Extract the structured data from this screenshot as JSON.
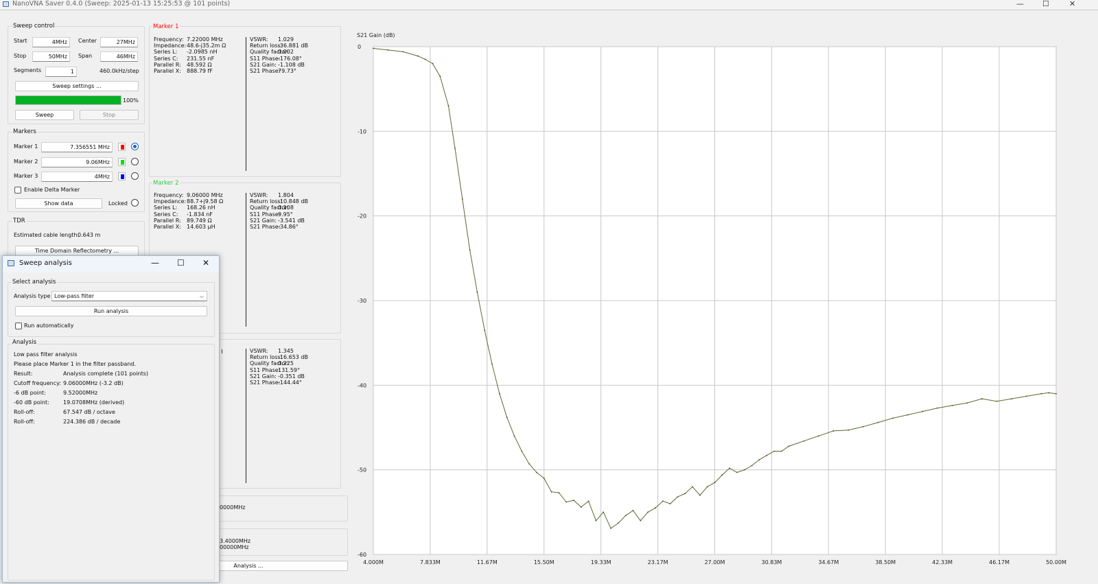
{
  "window": {
    "title": "NanoVNA Saver 0.4.0 (Sweep: 2025-01-13 15:25:53 @ 101 points)",
    "minimize": "—",
    "maximize": "☐",
    "close": "✕"
  },
  "sweep_control": {
    "title": "Sweep control",
    "start_label": "Start",
    "start_value": "4MHz",
    "center_label": "Center",
    "center_value": "27MHz",
    "stop_label": "Stop",
    "stop_value": "50MHz",
    "span_label": "Span",
    "span_value": "46MHz",
    "segments_label": "Segments",
    "segments_value": "1",
    "step_text": "460.0kHz/step",
    "settings_button": "Sweep settings ...",
    "progress": 100,
    "progress_text": "100%",
    "sweep_button": "Sweep",
    "stop_button": "Stop"
  },
  "markers": {
    "title": "Markers",
    "items": [
      {
        "label": "Marker 1",
        "value": "7.356551 MHz",
        "color": "#ff0000",
        "selected": true
      },
      {
        "label": "Marker 2",
        "value": "9.06MHz",
        "color": "#00e000",
        "selected": false
      },
      {
        "label": "Marker 3",
        "value": "4MHz",
        "color": "#0000ff",
        "selected": false
      }
    ],
    "delta_label": "Enable Delta Marker",
    "show_data_button": "Show data",
    "locked_label": "Locked"
  },
  "tdr": {
    "title": "TDR",
    "cable_label": "Estimated cable length:",
    "cable_value": "0.643 m",
    "tdr_button": "Time Domain Reflectometry ..."
  },
  "marker_panels": [
    {
      "title": "Marker 1",
      "color": "#ff0000",
      "left": [
        [
          "Frequency:",
          "7.22000 MHz"
        ],
        [
          "Impedance:",
          "48.6-j35.2m Ω"
        ],
        [
          "Series L:",
          "-2.0985 nH"
        ],
        [
          "Series C:",
          "231.55 nF"
        ],
        [
          "Parallel R:",
          "48.592 Ω"
        ],
        [
          "Parallel X:",
          "888.79 fF"
        ]
      ],
      "right": [
        [
          "VSWR:",
          "1.029"
        ],
        [
          "Return loss:",
          "-36.881 dB"
        ],
        [
          "Quality factor:",
          "0.002"
        ],
        [
          "S11 Phase:",
          "-176.08°"
        ],
        [
          "S21 Gain:",
          "-1.108 dB"
        ],
        [
          "S21 Phase:",
          "79.73°"
        ]
      ]
    },
    {
      "title": "Marker 2",
      "color": "#2ecc40",
      "left": [
        [
          "Frequency:",
          "9.06000 MHz"
        ],
        [
          "Impedance:",
          "88.7+j9.58 Ω"
        ],
        [
          "Series L:",
          "168.26 nH"
        ],
        [
          "Series C:",
          "-1.834 nF"
        ],
        [
          "Parallel R:",
          "89.749 Ω"
        ],
        [
          "Parallel X:",
          "14.603 µH"
        ]
      ],
      "right": [
        [
          "VSWR:",
          "1.804"
        ],
        [
          "Return loss:",
          "-10.848 dB"
        ],
        [
          "Quality factor:",
          "0.108"
        ],
        [
          "S11 Phase:",
          "9.95°"
        ],
        [
          "S21 Gain:",
          "-3.541 dB"
        ],
        [
          "S21 Phase:",
          "-34.86°"
        ]
      ]
    },
    {
      "right": [
        [
          "VSWR:",
          "1.345"
        ],
        [
          "Return loss:",
          "-16.653 dB"
        ],
        [
          "Quality factor:",
          "0.225"
        ],
        [
          "S11 Phase:",
          "131.59°"
        ],
        [
          "S21 Gain:",
          "-0.351 dB"
        ],
        [
          "S21 Phase:",
          "-144.44°"
        ]
      ]
    }
  ],
  "partial_panels": {
    "freq_a": "0000MHz",
    "freq_b": "3.4000MHz",
    "freq_c": "00000MHz",
    "analysis_button": "Analysis ..."
  },
  "dialog": {
    "title": "Sweep analysis",
    "select_title": "Select analysis",
    "type_label": "Analysis type",
    "type_value": "Low-pass filter",
    "run_button": "Run analysis",
    "auto_label": "Run automatically",
    "analysis_title": "Analysis",
    "heading": "Low pass filter analysis",
    "instruction": "Please place Marker 1 in the filter passband.",
    "results": [
      [
        "Result:",
        "Analysis complete (101 points)"
      ],
      [
        "Cutoff frequency:",
        "9.06000MHz (-3.2 dB)"
      ],
      [
        "-6 dB point:",
        "9.52000MHz"
      ],
      [
        "-60 dB point:",
        "19.0708MHz (derived)"
      ],
      [
        "Roll-off:",
        "67.547 dB / octave"
      ],
      [
        "Roll-off:",
        "224.386 dB / decade"
      ]
    ]
  },
  "chart_data": {
    "type": "line",
    "title": "S21 Gain (dB)",
    "xlim": [
      4.0,
      50.0
    ],
    "ylim": [
      -60,
      0
    ],
    "x_tick_labels": [
      "4.000M",
      "7.833M",
      "11.67M",
      "15.50M",
      "19.33M",
      "23.17M",
      "27.00M",
      "30.83M",
      "34.67M",
      "38.50M",
      "42.33M",
      "46.17M",
      "50.00M"
    ],
    "y_tick_values": [
      0,
      -10,
      -20,
      -30,
      -40,
      -50,
      -60
    ],
    "y_tick_labels": [
      "0",
      "-10",
      "-20",
      "-30",
      "-40",
      "-50",
      "-60"
    ],
    "grid": true,
    "line_color": "#556b2f",
    "series": [
      {
        "x_unit": "MHz",
        "x": [
          4.0,
          5.0,
          6.0,
          7.0,
          7.5,
          8.0,
          8.5,
          9.06,
          9.5,
          10.0,
          10.5,
          11.0,
          11.5,
          12.0,
          12.5,
          13.0,
          13.5,
          14.0,
          14.5,
          15.0,
          15.5,
          16.0,
          16.5,
          17.0,
          17.5,
          18.0,
          18.5,
          19.0,
          19.5,
          20.0,
          20.5,
          21.0,
          21.5,
          22.0,
          22.5,
          23.0,
          23.5,
          24.0,
          24.5,
          25.0,
          25.5,
          26.0,
          26.5,
          27.0,
          27.5,
          28.0,
          28.5,
          29.0,
          29.5,
          30.0,
          30.5,
          31.0,
          31.5,
          32.0,
          33.0,
          34.0,
          35.0,
          36.0,
          37.0,
          38.0,
          39.0,
          40.0,
          41.0,
          42.0,
          43.0,
          44.0,
          45.0,
          46.0,
          47.0,
          48.0,
          49.0,
          49.5,
          50.0
        ],
        "y": [
          -0.2,
          -0.4,
          -0.6,
          -1.1,
          -1.5,
          -2.0,
          -3.5,
          -7.0,
          -12.0,
          -18.0,
          -24.0,
          -29.0,
          -33.5,
          -37.5,
          -41.0,
          -43.8,
          -46.0,
          -47.8,
          -49.3,
          -50.3,
          -51.0,
          -52.6,
          -52.7,
          -53.8,
          -53.6,
          -54.4,
          -53.7,
          -56.0,
          -55.0,
          -56.9,
          -56.3,
          -55.4,
          -54.8,
          -56.0,
          -55.0,
          -54.5,
          -53.7,
          -54.0,
          -53.2,
          -52.8,
          -52.0,
          -53.0,
          -52.0,
          -51.5,
          -50.6,
          -49.8,
          -50.3,
          -50.0,
          -49.5,
          -48.8,
          -48.3,
          -47.8,
          -47.8,
          -47.2,
          -46.6,
          -46.0,
          -45.4,
          -45.3,
          -44.9,
          -44.4,
          -43.9,
          -43.5,
          -43.1,
          -42.7,
          -42.4,
          -42.1,
          -41.6,
          -41.9,
          -41.6,
          -41.3,
          -41.0,
          -40.9,
          -41.0
        ]
      }
    ]
  }
}
